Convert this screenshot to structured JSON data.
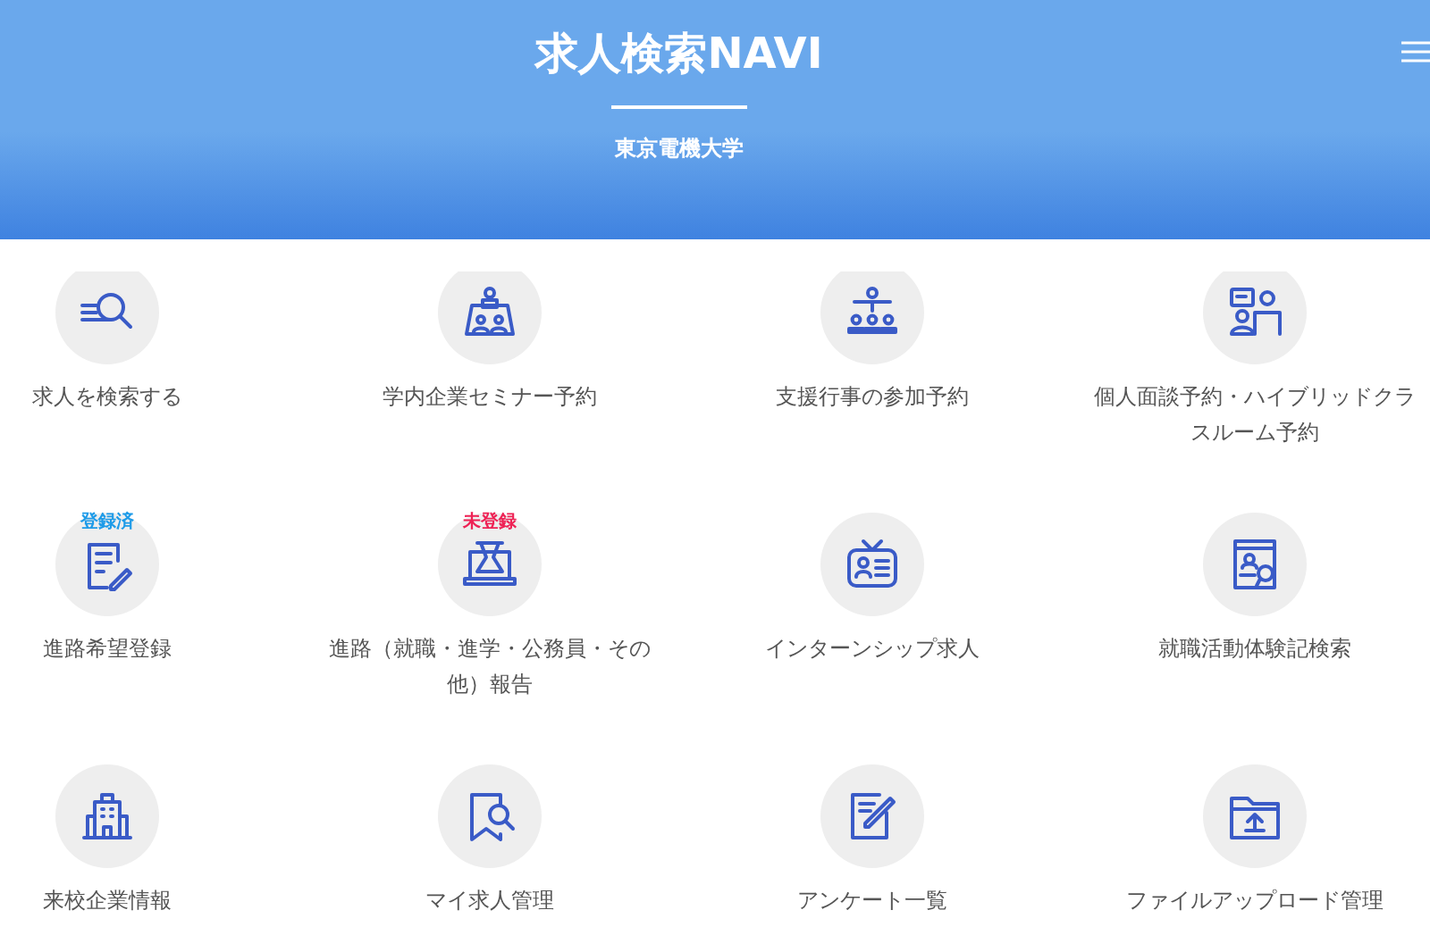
{
  "header": {
    "title": "求人検索NAVI",
    "subtitle": "東京電機大学"
  },
  "menu": [
    {
      "label": "求人を検索する"
    },
    {
      "label": "学内企業セミナー予約"
    },
    {
      "label": "支援行事の参加予約"
    },
    {
      "label": "個人面談予約・ハイブリッドクラスルーム予約"
    },
    {
      "label": "進路希望登録",
      "badge": {
        "text": "登録済",
        "kind": "registered"
      }
    },
    {
      "label": "進路（就職・進学・公務員・その他）報告",
      "badge": {
        "text": "未登録",
        "kind": "unregistered"
      }
    },
    {
      "label": "インターンシップ求人"
    },
    {
      "label": "就職活動体験記検索"
    },
    {
      "label": "来校企業情報"
    },
    {
      "label": "マイ求人管理"
    },
    {
      "label": "アンケート一覧"
    },
    {
      "label": "ファイルアップロード管理"
    }
  ]
}
